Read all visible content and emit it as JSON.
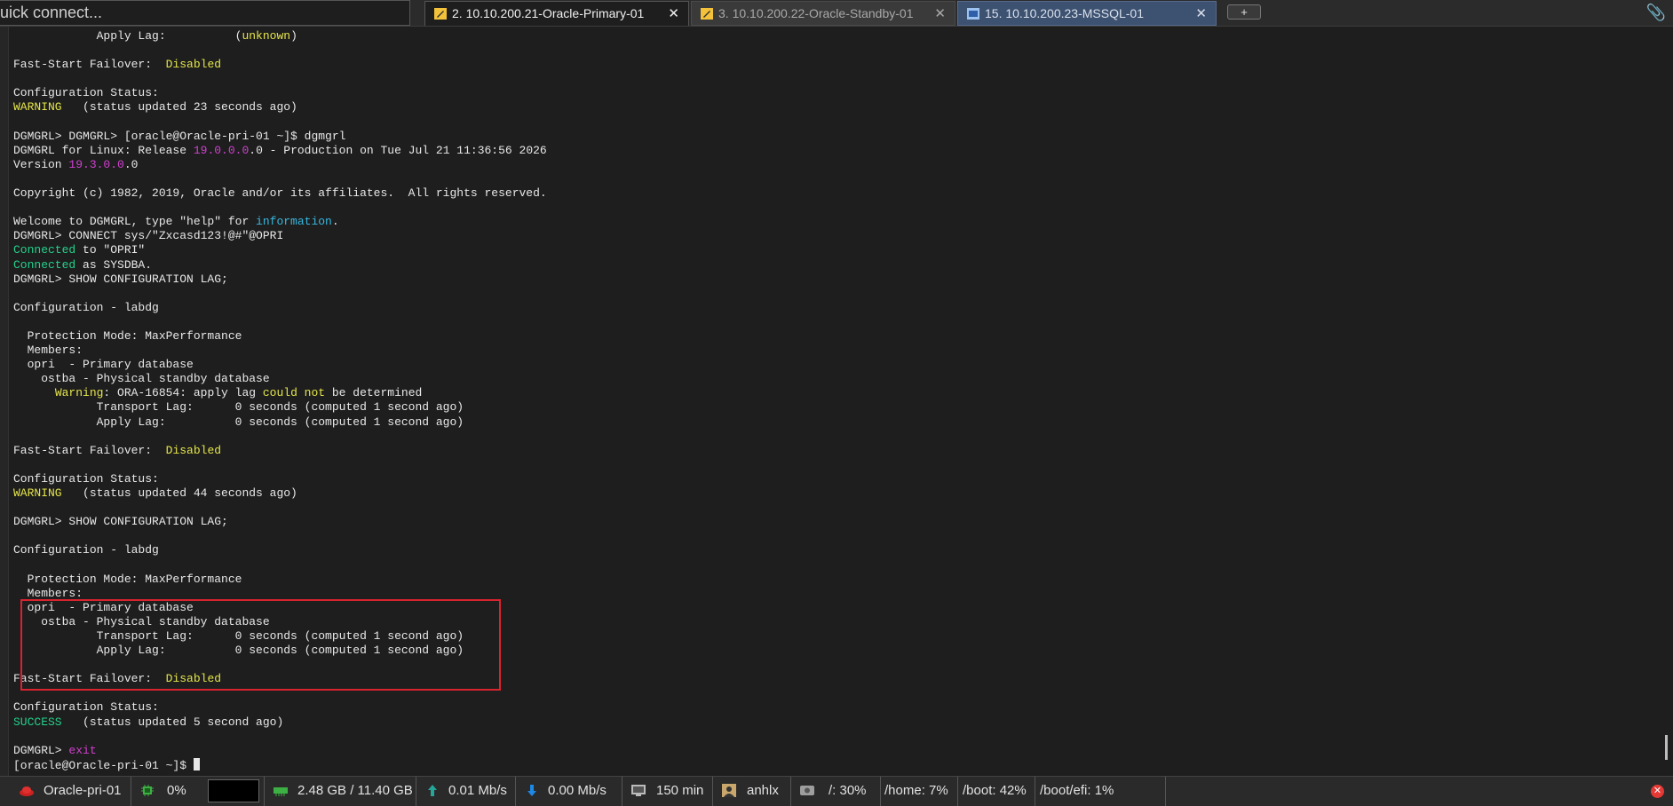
{
  "quick_connect": {
    "placeholder": "uick connect..."
  },
  "tabs": [
    {
      "label": "2. 10.10.200.21-Oracle-Primary-01",
      "icon": "terminal-pen-icon",
      "active": true
    },
    {
      "label": "3. 10.10.200.22-Oracle-Standby-01",
      "icon": "terminal-pen-icon",
      "active": false
    },
    {
      "label": "15. 10.10.200.23-MSSQL-01",
      "icon": "rdp-window-icon",
      "active": false
    }
  ],
  "new_tab_label": "+",
  "colors": {
    "yellow": "#e5e54b",
    "magenta": "#d040d0",
    "cyan": "#38b8e0",
    "green": "#23d18b",
    "default": "#e8e8e8",
    "highlight_box": "#d9232f"
  },
  "terminal_lines": [
    [
      {
        "t": "            Apply Lag:          ("
      },
      {
        "t": "unknown",
        "c": "yellow"
      },
      {
        "t": ")"
      }
    ],
    [
      {
        "t": ""
      }
    ],
    [
      {
        "t": "Fast-Start Failover:  "
      },
      {
        "t": "Disabled",
        "c": "yellow"
      }
    ],
    [
      {
        "t": ""
      }
    ],
    [
      {
        "t": "Configuration Status:"
      }
    ],
    [
      {
        "t": "WARNING",
        "c": "yellow"
      },
      {
        "t": "   (status updated 23 seconds ago)"
      }
    ],
    [
      {
        "t": ""
      }
    ],
    [
      {
        "t": "DGMGRL> DGMGRL> [oracle@Oracle-pri-01 ~]$ dgmgrl"
      }
    ],
    [
      {
        "t": "DGMGRL for Linux: Release "
      },
      {
        "t": "19.0.0.0",
        "c": "magenta"
      },
      {
        "t": ".0 - Production on Tue Jul 21 11:36:56 2026"
      }
    ],
    [
      {
        "t": "Version "
      },
      {
        "t": "19.3.0.0",
        "c": "magenta"
      },
      {
        "t": ".0"
      }
    ],
    [
      {
        "t": ""
      }
    ],
    [
      {
        "t": "Copyright (c) 1982, 2019, Oracle and/or its affiliates.  All rights reserved."
      }
    ],
    [
      {
        "t": ""
      }
    ],
    [
      {
        "t": "Welcome to DGMGRL, type \"help\" for "
      },
      {
        "t": "information",
        "c": "cyan"
      },
      {
        "t": "."
      }
    ],
    [
      {
        "t": "DGMGRL> CONNECT sys/\"Zxcasd123!@#\"@OPRI"
      }
    ],
    [
      {
        "t": "Connected",
        "c": "green"
      },
      {
        "t": " to \"OPRI\""
      }
    ],
    [
      {
        "t": "Connected",
        "c": "green"
      },
      {
        "t": " as SYSDBA."
      }
    ],
    [
      {
        "t": "DGMGRL> SHOW CONFIGURATION LAG;"
      }
    ],
    [
      {
        "t": ""
      }
    ],
    [
      {
        "t": "Configuration - labdg"
      }
    ],
    [
      {
        "t": ""
      }
    ],
    [
      {
        "t": "  Protection Mode: MaxPerformance"
      }
    ],
    [
      {
        "t": "  Members:"
      }
    ],
    [
      {
        "t": "  opri  - Primary database"
      }
    ],
    [
      {
        "t": "    ostba - Physical standby database"
      }
    ],
    [
      {
        "t": "      "
      },
      {
        "t": "Warning",
        "c": "yellow"
      },
      {
        "t": ": ORA-16854: apply lag "
      },
      {
        "t": "could not",
        "c": "yellow"
      },
      {
        "t": " be determined"
      }
    ],
    [
      {
        "t": "            Transport Lag:      0 seconds (computed 1 second ago)"
      }
    ],
    [
      {
        "t": "            Apply Lag:          0 seconds (computed 1 second ago)"
      }
    ],
    [
      {
        "t": ""
      }
    ],
    [
      {
        "t": "Fast-Start Failover:  "
      },
      {
        "t": "Disabled",
        "c": "yellow"
      }
    ],
    [
      {
        "t": ""
      }
    ],
    [
      {
        "t": "Configuration Status:"
      }
    ],
    [
      {
        "t": "WARNING",
        "c": "yellow"
      },
      {
        "t": "   (status updated 44 seconds ago)"
      }
    ],
    [
      {
        "t": ""
      }
    ],
    [
      {
        "t": "DGMGRL> SHOW CONFIGURATION LAG;"
      }
    ],
    [
      {
        "t": ""
      }
    ],
    [
      {
        "t": "Configuration - labdg"
      }
    ],
    [
      {
        "t": ""
      }
    ],
    [
      {
        "t": "  Protection Mode: MaxPerformance"
      }
    ],
    [
      {
        "t": "  Members:"
      }
    ],
    [
      {
        "t": "  opri  - Primary database"
      }
    ],
    [
      {
        "t": "    ostba - Physical standby database"
      }
    ],
    [
      {
        "t": "            Transport Lag:      0 seconds (computed 1 second ago)"
      }
    ],
    [
      {
        "t": "            Apply Lag:          0 seconds (computed 1 second ago)"
      }
    ],
    [
      {
        "t": ""
      }
    ],
    [
      {
        "t": "Fast-Start Failover:  "
      },
      {
        "t": "Disabled",
        "c": "yellow"
      }
    ],
    [
      {
        "t": ""
      }
    ],
    [
      {
        "t": "Configuration Status:"
      }
    ],
    [
      {
        "t": "SUCCESS",
        "c": "green"
      },
      {
        "t": "   (status updated 5 second ago)"
      }
    ],
    [
      {
        "t": ""
      }
    ],
    [
      {
        "t": "DGMGRL> "
      },
      {
        "t": "exit",
        "c": "magenta"
      }
    ],
    [
      {
        "t": "[oracle@Oracle-pri-01 ~]$ "
      }
    ]
  ],
  "status_bar": {
    "host": "Oracle-pri-01",
    "cpu": "0%",
    "memory": "2.48 GB / 11.40 GB",
    "upload": "0.01 Mb/s",
    "download": "0.00 Mb/s",
    "uptime": "150 min",
    "user": "anhlx",
    "disk_root": "/: 30%",
    "disk_home": "/home: 7%",
    "disk_boot": "/boot: 42%",
    "disk_boot_efi": "/boot/efi: 1%"
  }
}
